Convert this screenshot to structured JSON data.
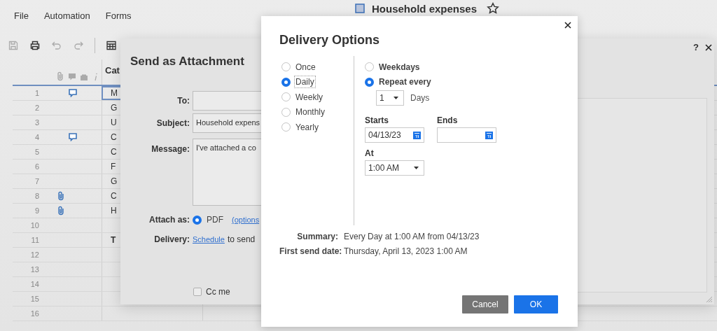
{
  "app": {
    "menu": [
      {
        "label": "File"
      },
      {
        "label": "Automation"
      },
      {
        "label": "Forms"
      }
    ],
    "title": "Household expenses",
    "toolbar": [
      {
        "kind": "save",
        "disabled": true
      },
      {
        "kind": "print",
        "disabled": false
      },
      {
        "kind": "undo",
        "disabled": true
      },
      {
        "kind": "redo",
        "disabled": true
      },
      {
        "kind": "separator"
      },
      {
        "kind": "grid",
        "disabled": false
      }
    ],
    "grid": {
      "column_headers": [
        "Cat"
      ],
      "rows": [
        {
          "number": "1",
          "attachment": false,
          "comment": true,
          "cell": "M",
          "bold": false,
          "selected": true
        },
        {
          "number": "2",
          "attachment": false,
          "comment": false,
          "cell": "G",
          "bold": false,
          "selected": false
        },
        {
          "number": "3",
          "attachment": false,
          "comment": false,
          "cell": "U",
          "bold": false,
          "selected": false
        },
        {
          "number": "4",
          "attachment": false,
          "comment": true,
          "cell": "C",
          "bold": false,
          "selected": false
        },
        {
          "number": "5",
          "attachment": false,
          "comment": false,
          "cell": "C",
          "bold": false,
          "selected": false
        },
        {
          "number": "6",
          "attachment": false,
          "comment": false,
          "cell": "F",
          "bold": false,
          "selected": false
        },
        {
          "number": "7",
          "attachment": false,
          "comment": false,
          "cell": "G",
          "bold": false,
          "selected": false
        },
        {
          "number": "8",
          "attachment": true,
          "comment": false,
          "cell": "C",
          "bold": false,
          "selected": false
        },
        {
          "number": "9",
          "attachment": true,
          "comment": false,
          "cell": "H",
          "bold": false,
          "selected": false
        },
        {
          "number": "10",
          "attachment": false,
          "comment": false,
          "selected": false
        },
        {
          "number": "11",
          "attachment": false,
          "comment": false,
          "cell": "T",
          "bold": true,
          "selected": false
        },
        {
          "number": "12",
          "attachment": false,
          "comment": false,
          "selected": false
        },
        {
          "number": "13",
          "attachment": false,
          "comment": false,
          "selected": false
        },
        {
          "number": "14",
          "attachment": false,
          "comment": false,
          "selected": false
        },
        {
          "number": "15",
          "attachment": false,
          "comment": false,
          "selected": false
        },
        {
          "number": "16",
          "attachment": false,
          "comment": false,
          "selected": false
        }
      ]
    }
  },
  "send_dialog": {
    "title": "Send as Attachment",
    "help": "?",
    "fields": [
      {
        "label": "To:",
        "kind": "input"
      },
      {
        "label": "Subject:",
        "kind": "input",
        "value": "Household expens"
      },
      {
        "label": "Message:",
        "kind": "textarea",
        "value": "I've attached a co"
      }
    ],
    "attach_as": {
      "label": "Attach as:",
      "options": [
        {
          "label": "PDF",
          "selected": true
        }
      ],
      "link": "(options"
    },
    "delivery": {
      "label": "Delivery:",
      "link": "Schedule",
      "text": "to send"
    },
    "cc_me": {
      "label": "Cc me",
      "checked": false
    }
  },
  "delivery_dialog": {
    "title": "Delivery Options",
    "frequency": [
      {
        "label": "Once",
        "selected": false,
        "focused": false
      },
      {
        "label": "Daily",
        "selected": true,
        "focused": true
      },
      {
        "label": "Weekly",
        "selected": false,
        "focused": false
      },
      {
        "label": "Monthly",
        "selected": false,
        "focused": false
      },
      {
        "label": "Yearly",
        "selected": false,
        "focused": false
      }
    ],
    "repeat": [
      {
        "label": "Weekdays",
        "selected": false
      },
      {
        "label": "Repeat every",
        "selected": true
      }
    ],
    "interval": {
      "value": "1",
      "unit": "Days"
    },
    "starts": {
      "label": "Starts",
      "value": "04/13/23"
    },
    "ends": {
      "label": "Ends"
    },
    "at": {
      "label": "At",
      "value": "1:00 AM"
    },
    "summary": [
      {
        "label": "Summary:",
        "value": "Every Day at 1:00 AM from 04/13/23"
      },
      {
        "label": "First send date:",
        "value": "Thursday, April 13, 2023 1:00 AM"
      }
    ],
    "buttons": [
      {
        "label": "Cancel",
        "kind": "secondary"
      },
      {
        "label": "OK",
        "kind": "primary"
      }
    ]
  }
}
